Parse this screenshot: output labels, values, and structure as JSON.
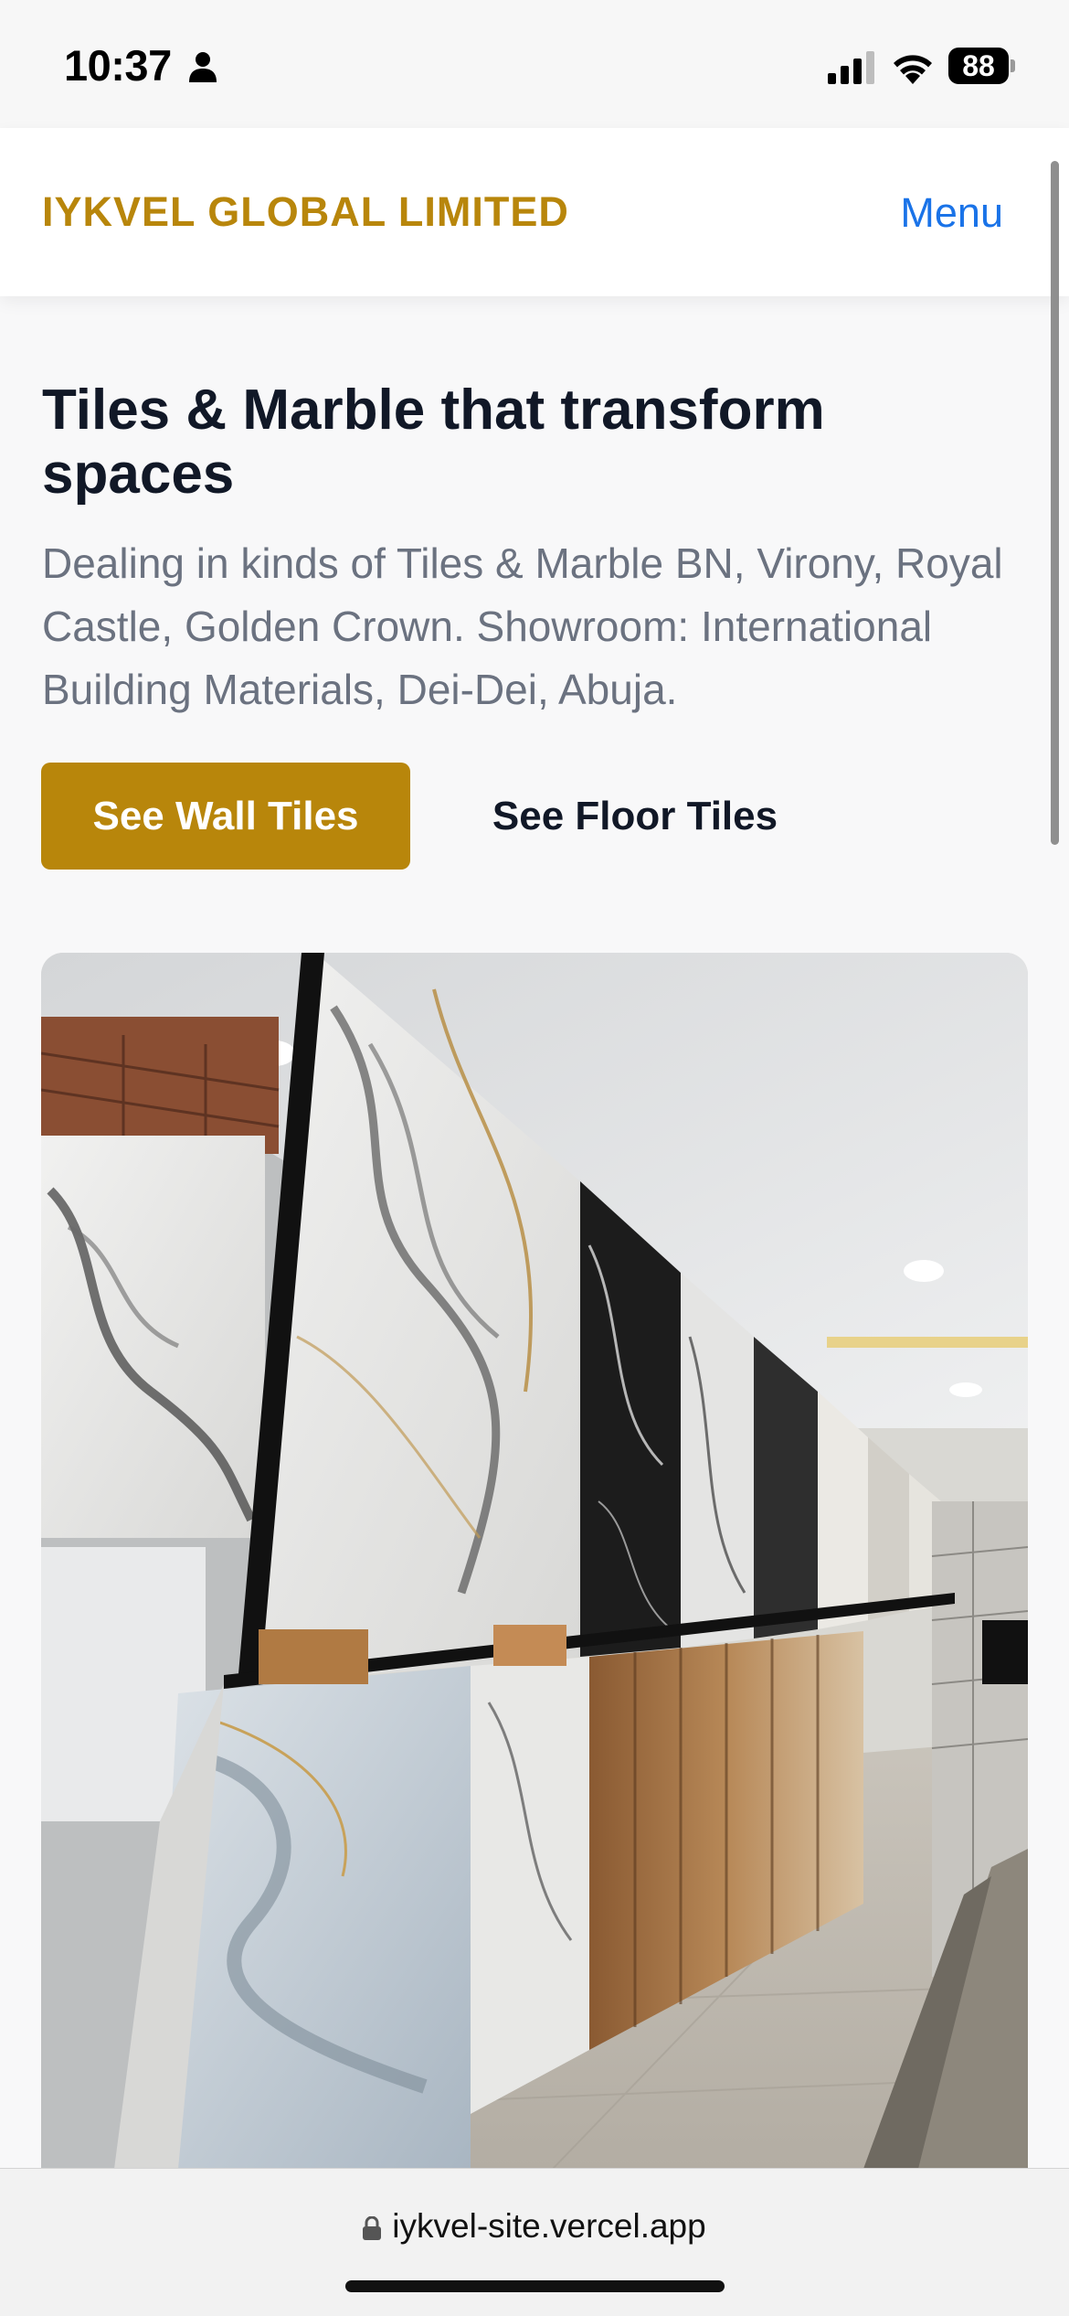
{
  "status_bar": {
    "time": "10:37",
    "battery": "88",
    "icons": [
      "person-icon",
      "cellular-signal-icon",
      "wifi-icon",
      "battery-icon"
    ]
  },
  "header": {
    "brand": "IYKVEL GLOBAL LIMITED",
    "menu_label": "Menu"
  },
  "hero": {
    "title": "Tiles & Marble that transform spaces",
    "description": "Dealing in kinds of Tiles & Marble BN, Virony, Royal Castle, Golden Crown. Showroom: International Building Materials, Dei-Dei, Abuja.",
    "primary_button": "See Wall Tiles",
    "secondary_button": "See Floor Tiles"
  },
  "browser": {
    "url": "iykvel-site.vercel.app"
  },
  "colors": {
    "brand_gold": "#b8860b",
    "link_blue": "#1a73e8",
    "heading": "#111827",
    "body_text": "#6b7280"
  }
}
